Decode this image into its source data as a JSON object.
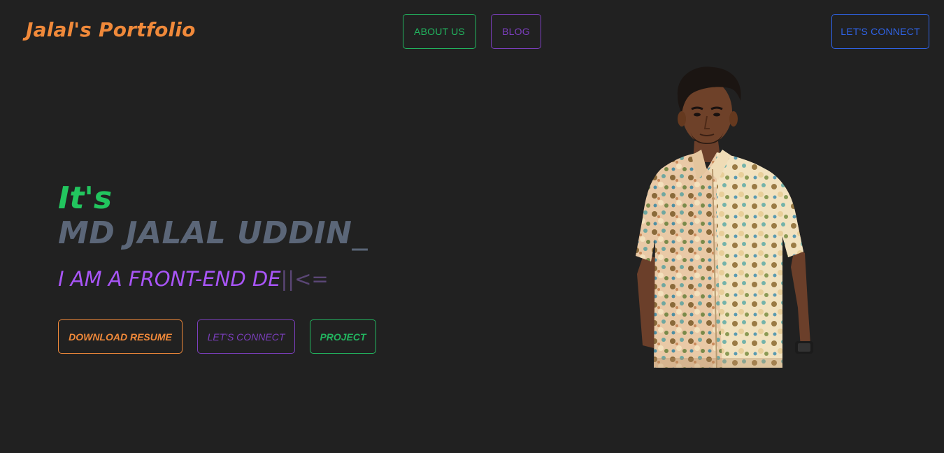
{
  "header": {
    "brand": "Jalal's Portfolio",
    "nav": {
      "about": "ABOUT US",
      "blog": "BLOG"
    },
    "connect_label": "LET'S CONNECT"
  },
  "hero": {
    "greeting": "It's",
    "name": "MD JALAL UDDIN",
    "name_cursor": "_",
    "role_typed": "I AM A FRONT-END DE",
    "role_cursor": "||<=",
    "buttons": {
      "resume": "DOWNLOAD RESUME",
      "connect": "LET'S CONNECT",
      "project": "PROJECT"
    }
  },
  "colors": {
    "background": "#212121",
    "brand": "#f0893a",
    "green": "#22b55f",
    "purple": "#7c3fbe",
    "blue": "#2f63e6",
    "name_gray": "#5b6678",
    "role_purple": "#a855f7"
  }
}
